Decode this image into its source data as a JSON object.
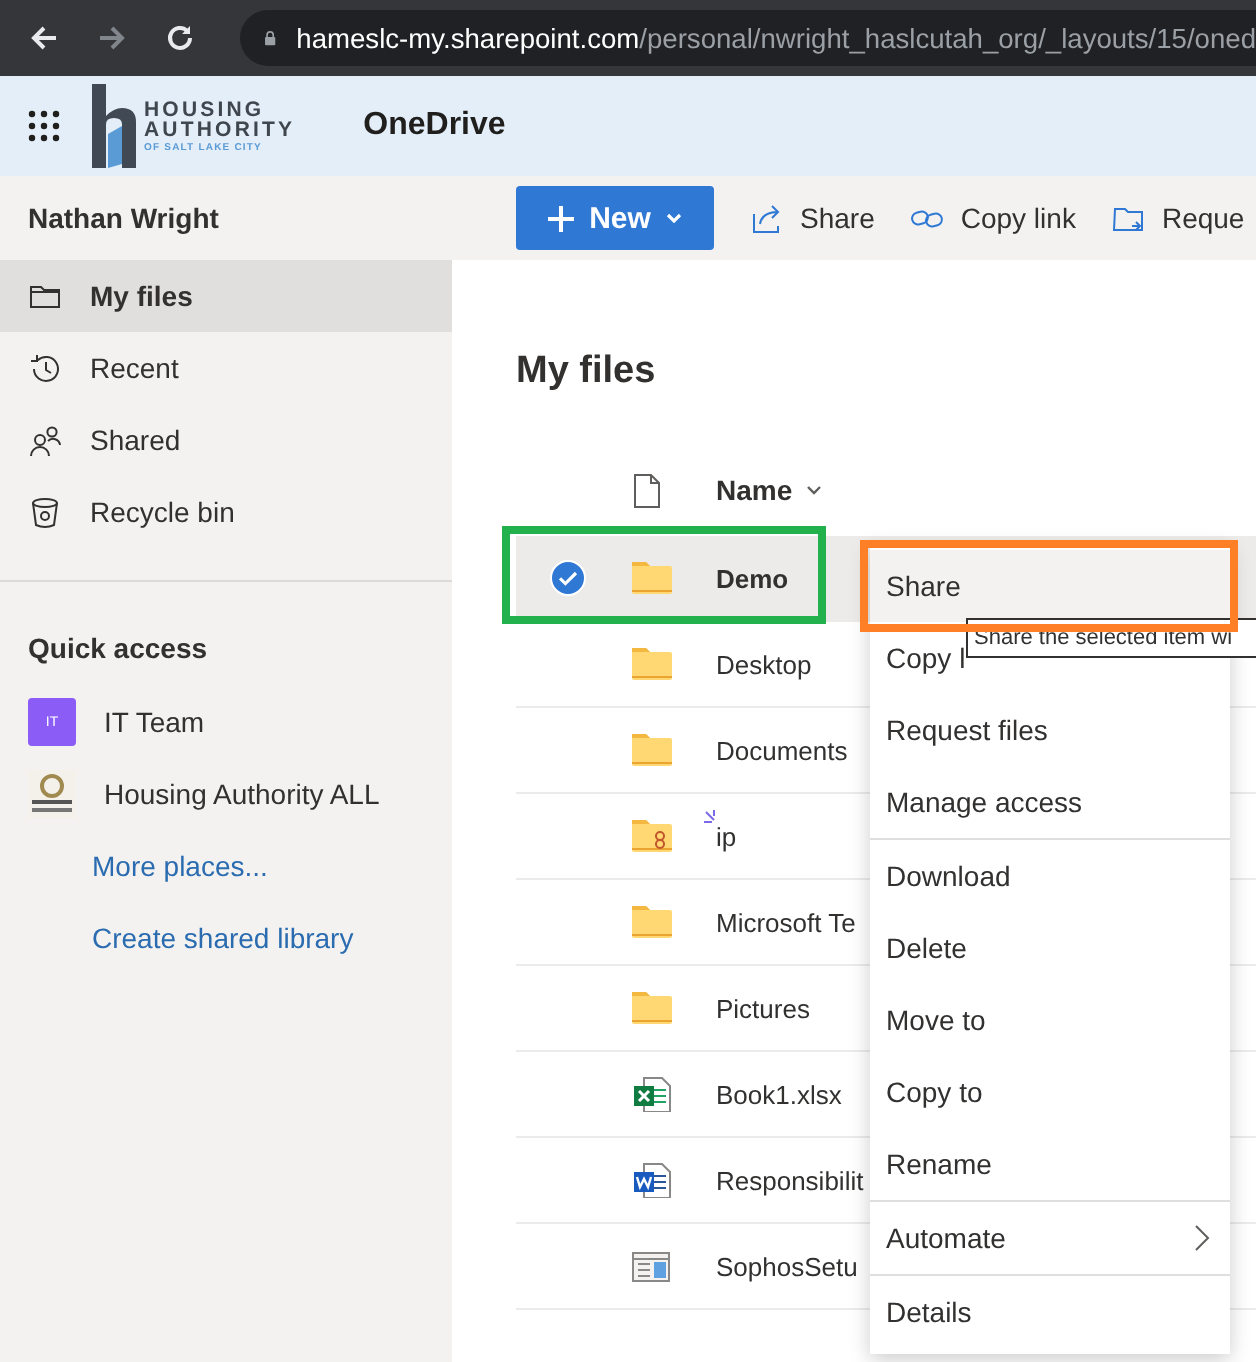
{
  "browser": {
    "url_host": "hameslc-my.sharepoint.com",
    "url_path": "/personal/nwright_haslcutah_org/_layouts/15/oned"
  },
  "header": {
    "logo_lines": [
      "HOUSING",
      "AUTHORITY",
      "OF SALT LAKE CITY"
    ],
    "app_name": "OneDrive"
  },
  "sidebar": {
    "user": "Nathan Wright",
    "items": [
      {
        "label": "My files",
        "kind": "folder",
        "selected": true
      },
      {
        "label": "Recent",
        "kind": "recent",
        "selected": false
      },
      {
        "label": "Shared",
        "kind": "shared",
        "selected": false
      },
      {
        "label": "Recycle bin",
        "kind": "bin",
        "selected": false
      }
    ],
    "quick_access_title": "Quick access",
    "quick_access": [
      {
        "kind": "site",
        "label": "IT Team",
        "badge": "IT"
      },
      {
        "kind": "logo-site",
        "label": "Housing Authority ALL"
      },
      {
        "kind": "link",
        "label": "More places..."
      },
      {
        "kind": "link",
        "label": "Create shared library"
      }
    ]
  },
  "command_bar": [
    {
      "kind": "primary",
      "label": "New"
    },
    {
      "kind": "share",
      "label": "Share"
    },
    {
      "kind": "link",
      "label": "Copy link"
    },
    {
      "kind": "request",
      "label": "Reque"
    }
  ],
  "page_title": "My files",
  "list": {
    "name_column": "Name",
    "rows": [
      {
        "name": "Demo",
        "kind": "folder",
        "selected": true,
        "new": false
      },
      {
        "name": "Desktop",
        "kind": "folder",
        "selected": false,
        "new": false
      },
      {
        "name": "Documents",
        "kind": "folder",
        "selected": false,
        "new": false
      },
      {
        "name": "ip",
        "kind": "shared-folder",
        "selected": false,
        "new": true
      },
      {
        "name": "Microsoft Te",
        "kind": "folder",
        "selected": false,
        "new": false
      },
      {
        "name": "Pictures",
        "kind": "folder",
        "selected": false,
        "new": false
      },
      {
        "name": "Book1.xlsx",
        "kind": "excel",
        "selected": false,
        "new": false
      },
      {
        "name": "Responsibilit",
        "kind": "word",
        "selected": false,
        "new": false
      },
      {
        "name": "SophosSetu",
        "kind": "exe",
        "selected": false,
        "new": false
      }
    ]
  },
  "context_menu": {
    "groups": [
      [
        {
          "label": "Share",
          "selected": true,
          "has_submenu": false
        },
        {
          "label": "Copy l",
          "selected": false,
          "has_submenu": false
        },
        {
          "label": "Request files",
          "selected": false,
          "has_submenu": false
        },
        {
          "label": "Manage access",
          "selected": false,
          "has_submenu": false
        }
      ],
      [
        {
          "label": "Download",
          "selected": false,
          "has_submenu": false
        },
        {
          "label": "Delete",
          "selected": false,
          "has_submenu": false
        },
        {
          "label": "Move to",
          "selected": false,
          "has_submenu": false
        },
        {
          "label": "Copy to",
          "selected": false,
          "has_submenu": false
        },
        {
          "label": "Rename",
          "selected": false,
          "has_submenu": false
        }
      ],
      [
        {
          "label": "Automate",
          "selected": false,
          "has_submenu": true
        }
      ],
      [
        {
          "label": "Details",
          "selected": false,
          "has_submenu": false
        }
      ]
    ]
  },
  "tooltip": "Share the selected item wi",
  "highlight_boxes": [
    {
      "color": "#22b14c"
    },
    {
      "color": "#ff7f27"
    }
  ]
}
